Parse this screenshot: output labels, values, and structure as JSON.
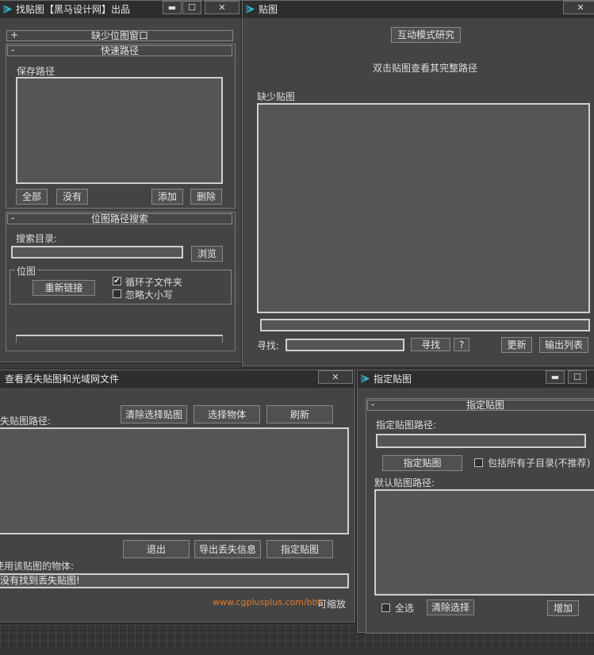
{
  "colors": {
    "accent_link": "#e07b2a",
    "window_bg": "#444444",
    "title_bg": "#2e2e2e"
  },
  "win1": {
    "title": "找贴图【黑马设计网】出品",
    "rollout_missing": {
      "sign": "+",
      "title": "缺少位图窗口"
    },
    "rollout_quick": {
      "sign": "-",
      "title": "快速路径",
      "save_path_label": "保存路径",
      "btn_all": "全部",
      "btn_none": "没有",
      "btn_add": "添加",
      "btn_delete": "删除"
    },
    "rollout_search": {
      "sign": "-",
      "title": "位图路径搜索",
      "search_dir_label": "搜索目录:",
      "search_dir_value": "",
      "btn_browse": "浏览",
      "group_bitmap": "位图",
      "btn_relink": "重新链接",
      "chk_recursive": "循环子文件夹",
      "chk_ignore_case": "忽略大小写"
    }
  },
  "win2": {
    "title": "贴图",
    "btn_interactive": "互动模式研究",
    "hint": "双击贴图查看其完整路径",
    "missing_label": "缺少贴图",
    "find_label": "寻找:",
    "find_value": "",
    "btn_find": "寻找",
    "btn_help": "?",
    "btn_update": "更新",
    "btn_export": "输出列表"
  },
  "win3": {
    "title": "查看丢失贴图和光域网文件",
    "missing_path_label": "丢失贴图路径:",
    "btn_clear_sel": "清除选择贴图",
    "btn_select_obj": "选择物体",
    "btn_refresh": "刷新",
    "btn_exit": "退出",
    "btn_export_info": "导出丢失信息",
    "btn_assign": "指定贴图",
    "objects_label": "使用该贴图的物体:",
    "status_text": "没有找到丢失贴图!",
    "link": "www.cgplusplus.com/bbs",
    "resizable": "可缩放"
  },
  "win4": {
    "title": "指定贴图",
    "rollout_title": "指定贴图",
    "rollout_sign": "-",
    "path_label": "指定贴图路径:",
    "path_value": "",
    "btn_assign": "指定贴图",
    "chk_subdirs": "包括所有子目录(不推荐)",
    "default_path_label": "默认贴图路径:",
    "chk_select_all": "全选",
    "btn_clear": "清除选择",
    "btn_add": "增加"
  },
  "icons": {
    "app_logo": "3dsmax-logo-icon",
    "check": "✔"
  }
}
